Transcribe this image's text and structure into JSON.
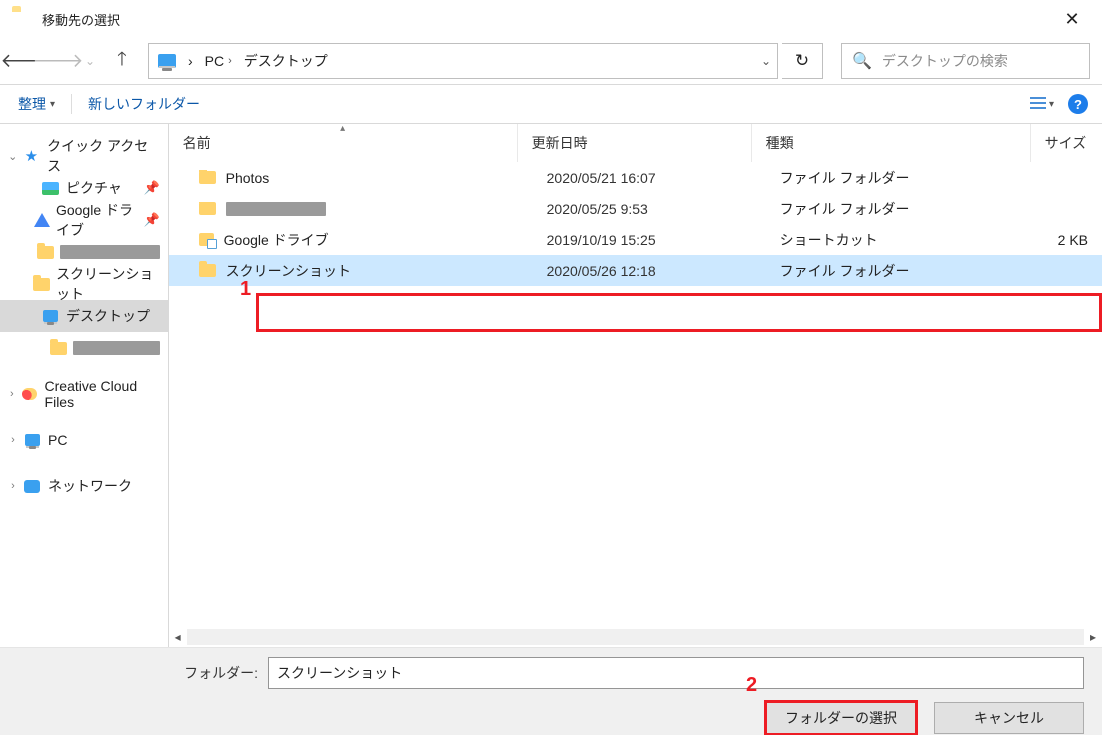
{
  "title": "移動先の選択",
  "breadcrumb": {
    "pc": "PC",
    "desktop": "デスクトップ"
  },
  "search": {
    "placeholder": "デスクトップの検索"
  },
  "toolbar": {
    "organize": "整理",
    "new_folder": "新しいフォルダー"
  },
  "columns": {
    "name": "名前",
    "date": "更新日時",
    "type": "種類",
    "size": "サイズ"
  },
  "sidebar": {
    "quick_access": "クイック アクセス",
    "items": [
      {
        "label": "ピクチャ",
        "pinned": true
      },
      {
        "label": "Google ドライブ",
        "pinned": true
      },
      {
        "label": "",
        "redacted": true
      },
      {
        "label": "スクリーンショット"
      },
      {
        "label": "デスクトップ",
        "active": true
      },
      {
        "label": "",
        "redacted": true
      }
    ],
    "creative_cloud": "Creative Cloud Files",
    "pc": "PC",
    "network": "ネットワーク"
  },
  "files": [
    {
      "name": "Photos",
      "date": "2020/05/21 16:07",
      "type": "ファイル フォルダー",
      "size": ""
    },
    {
      "name": "",
      "date": "2020/05/25 9:53",
      "type": "ファイル フォルダー",
      "size": "",
      "redacted": true
    },
    {
      "name": "Google ドライブ",
      "date": "2019/10/19 15:25",
      "type": "ショートカット",
      "size": "2 KB"
    },
    {
      "name": "スクリーンショット",
      "date": "2020/05/26 12:18",
      "type": "ファイル フォルダー",
      "size": "",
      "selected": true
    }
  ],
  "footer": {
    "folder_label": "フォルダー:",
    "folder_value": "スクリーンショット",
    "select_button": "フォルダーの選択",
    "cancel_button": "キャンセル"
  },
  "annotations": {
    "one": "1",
    "two": "2"
  }
}
